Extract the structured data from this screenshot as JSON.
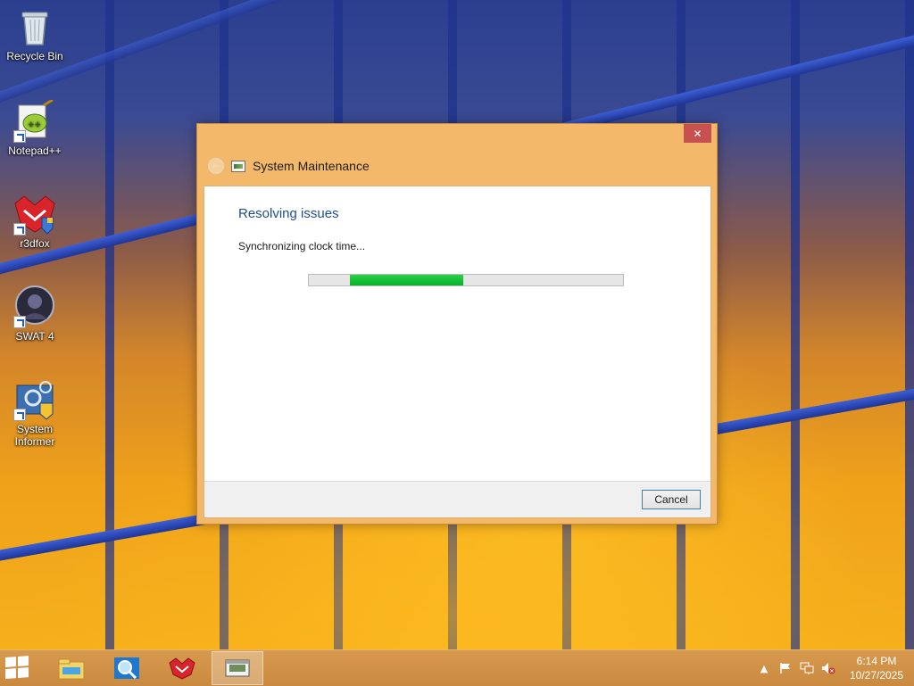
{
  "desktop": {
    "icons": [
      {
        "label": "Recycle Bin",
        "icon": "recycle-bin-icon"
      },
      {
        "label": "Notepad++",
        "icon": "notepad-plus-plus-icon"
      },
      {
        "label": "r3dfox",
        "icon": "r3dfox-icon"
      },
      {
        "label": "SWAT 4",
        "icon": "swat4-icon"
      },
      {
        "label_line1": "System",
        "label_line2": "Informer",
        "icon": "system-informer-icon"
      }
    ]
  },
  "window": {
    "title": "System Maintenance",
    "close_label": "✕",
    "back_label": "←",
    "heading": "Resolving issues",
    "status": "Synchronizing clock time...",
    "progress": {
      "start_fraction": 0.13,
      "end_fraction": 0.49,
      "color": "#06b025"
    },
    "cancel_label": "Cancel",
    "frame_color": "#f3b86a",
    "close_color": "#c75050"
  },
  "taskbar": {
    "items": [
      {
        "icon": "file-explorer-icon"
      },
      {
        "icon": "magnifier-icon"
      },
      {
        "icon": "r3dfox-icon"
      },
      {
        "icon": "system-maintenance-icon",
        "active": true
      }
    ],
    "tray": {
      "icons": [
        "show-hidden-icons-chevron",
        "action-center-flag-icon",
        "network-icon",
        "volume-muted-icon"
      ],
      "time": "6:14 PM",
      "date": "10/27/2025"
    },
    "color": "#d89a4e"
  }
}
